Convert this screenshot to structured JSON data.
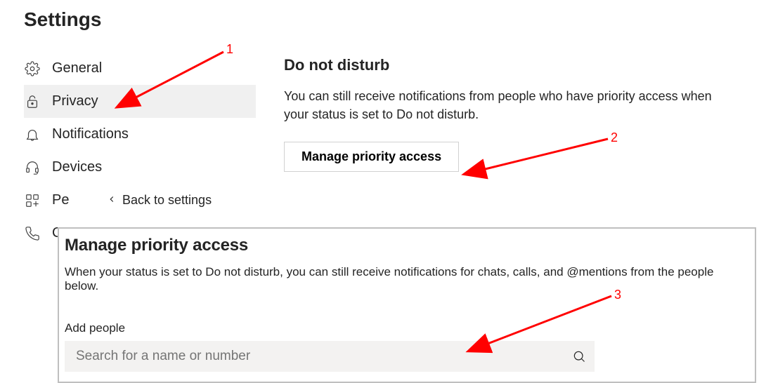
{
  "page_title": "Settings",
  "sidebar": {
    "items": [
      {
        "label": "General"
      },
      {
        "label": "Privacy"
      },
      {
        "label": "Notifications"
      },
      {
        "label": "Devices"
      },
      {
        "label_partial": "Pe"
      },
      {
        "label_partial": "Ca"
      }
    ]
  },
  "back_link": {
    "label": "Back to settings"
  },
  "dnd": {
    "title": "Do not disturb",
    "desc": "You can still receive notifications from people who have priority access when your status is set to Do not disturb.",
    "button": "Manage priority access"
  },
  "panel": {
    "title": "Manage priority access",
    "desc": "When your status is set to Do not disturb, you can still receive notifications for chats, calls, and @mentions from the people below.",
    "add_label": "Add people",
    "search_placeholder": "Search for a name or number"
  },
  "annotations": {
    "n1": "1",
    "n2": "2",
    "n3": "3"
  }
}
